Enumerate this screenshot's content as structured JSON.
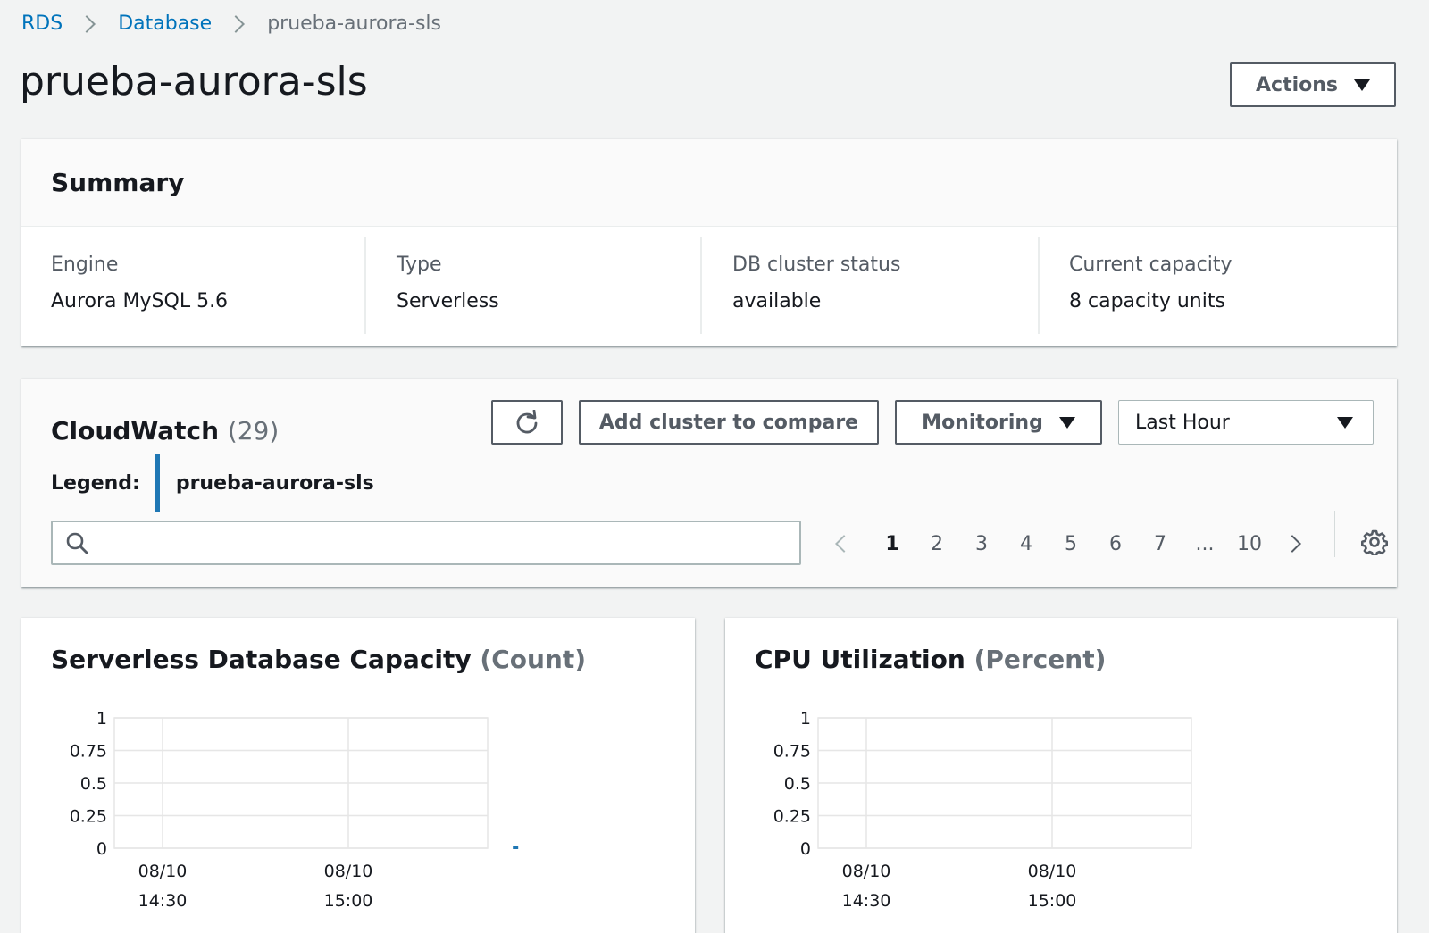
{
  "breadcrumb": {
    "items": [
      "RDS",
      "Database"
    ],
    "current": "prueba-aurora-sls"
  },
  "page_title": "prueba-aurora-sls",
  "actions_label": "Actions",
  "summary": {
    "title": "Summary",
    "fields": [
      {
        "label": "Engine",
        "value": "Aurora MySQL 5.6"
      },
      {
        "label": "Type",
        "value": "Serverless"
      },
      {
        "label": "DB cluster status",
        "value": "available"
      },
      {
        "label": "Current capacity",
        "value": "8 capacity units"
      }
    ]
  },
  "cloudwatch": {
    "title": "CloudWatch",
    "count": "(29)",
    "compare_label": "Add cluster to compare",
    "monitoring_label": "Monitoring",
    "time_range": "Last Hour",
    "legend_label": "Legend:",
    "legend_item": "prueba-aurora-sls",
    "search_value": "",
    "pages": [
      "1",
      "2",
      "3",
      "4",
      "5",
      "6",
      "7",
      "...",
      "10"
    ],
    "current_page": "1",
    "series_color": "#1f77b4"
  },
  "chart_data": [
    {
      "type": "line",
      "title": "Serverless Database Capacity",
      "unit": "(Count)",
      "ylim": [
        0,
        1
      ],
      "y_ticks": [
        "0",
        "0.25",
        "0.5",
        "0.75",
        "1"
      ],
      "x_ticks": [
        {
          "date": "08/10",
          "time": "14:30"
        },
        {
          "date": "08/10",
          "time": "15:00"
        }
      ],
      "grid": true,
      "series": [
        {
          "name": "prueba-aurora-sls",
          "color": "#1f77b4",
          "points": [
            {
              "x": "08/10 15:27",
              "y": 0
            }
          ]
        }
      ]
    },
    {
      "type": "line",
      "title": "CPU Utilization",
      "unit": "(Percent)",
      "ylim": [
        0,
        1
      ],
      "y_ticks": [
        "0",
        "0.25",
        "0.5",
        "0.75",
        "1"
      ],
      "x_ticks": [
        {
          "date": "08/10",
          "time": "14:30"
        },
        {
          "date": "08/10",
          "time": "15:00"
        }
      ],
      "grid": true,
      "series": []
    }
  ]
}
